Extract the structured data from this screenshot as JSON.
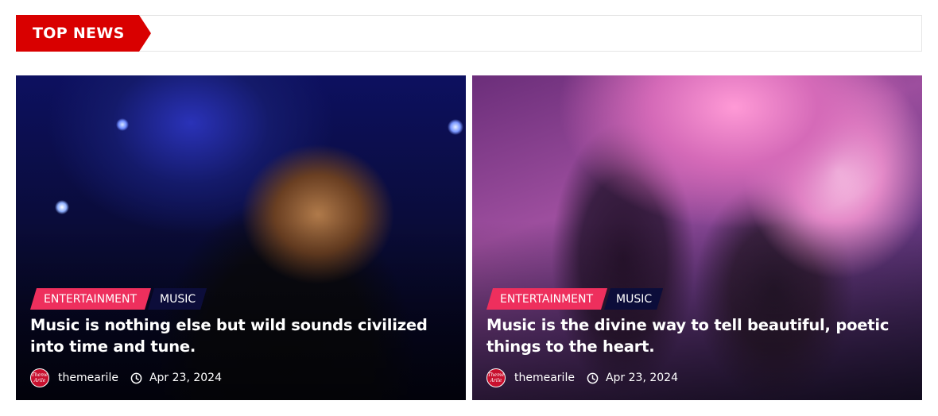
{
  "section": {
    "title": "TOP NEWS"
  },
  "articles": [
    {
      "categories": [
        "ENTERTAINMENT",
        "MUSIC"
      ],
      "title": "Music is nothing else but wild sounds civilized into time and tune.",
      "author": "themearile",
      "date": "Apr 23, 2024",
      "avatar_text": [
        "Theme",
        "Arile"
      ]
    },
    {
      "categories": [
        "ENTERTAINMENT",
        "MUSIC"
      ],
      "title": "Music is the divine way to tell beautiful, poetic things to the heart.",
      "author": "themearile",
      "date": "Apr 23, 2024",
      "avatar_text": [
        "Theme",
        "Arile"
      ]
    }
  ],
  "colors": {
    "section_accent": "#d90000",
    "tag_entertainment": "#ee2f5d",
    "tag_music": "#0c0d3a"
  },
  "icons": {
    "clock": "clock-icon",
    "avatar": "author-avatar"
  }
}
